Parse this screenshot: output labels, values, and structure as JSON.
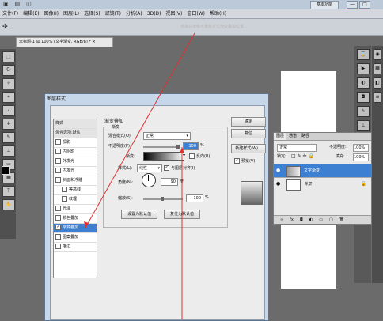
{
  "titlebar": {
    "workspace_button": "基本功能",
    "window_controls": [
      "—",
      "□",
      "×"
    ]
  },
  "menu": [
    "文件(F)",
    "编辑(E)",
    "图像(I)",
    "图层(L)",
    "选择(S)",
    "滤镜(T)",
    "分析(A)",
    "3D(D)",
    "视图(V)",
    "窗口(W)",
    "帮助(H)"
  ],
  "options_hint": "点按并拖移可重新定位渐变叠加位置...",
  "document_tab": "未标题-1 @ 100% (文字渐变, RGB/8) * ×",
  "layers_panel": {
    "tabs": [
      "图层",
      "通道",
      "路径"
    ],
    "blend_mode": "正常",
    "opacity_label": "不透明度:",
    "opacity_value": "100%",
    "lock_label": "锁定:",
    "fill_label": "填充:",
    "fill_value": "100%",
    "layers": [
      {
        "name": "文字渐变",
        "selected": true
      },
      {
        "name": "背景",
        "selected": false
      }
    ]
  },
  "dialog": {
    "title": "图层样式",
    "styles_header": "样式",
    "blend_options": "混合选项:默认",
    "style_items": [
      {
        "label": "投影",
        "checked": false,
        "indent": false
      },
      {
        "label": "内阴影",
        "checked": false,
        "indent": false
      },
      {
        "label": "外发光",
        "checked": false,
        "indent": false
      },
      {
        "label": "内发光",
        "checked": false,
        "indent": false
      },
      {
        "label": "斜面和浮雕",
        "checked": false,
        "indent": false
      },
      {
        "label": "等高线",
        "checked": false,
        "indent": true
      },
      {
        "label": "纹理",
        "checked": false,
        "indent": true
      },
      {
        "label": "光泽",
        "checked": false,
        "indent": false
      },
      {
        "label": "颜色叠加",
        "checked": false,
        "indent": false
      },
      {
        "label": "渐变叠加",
        "checked": true,
        "indent": false,
        "selected": true
      },
      {
        "label": "图案叠加",
        "checked": false,
        "indent": false
      },
      {
        "label": "描边",
        "checked": false,
        "indent": false
      }
    ],
    "section_title": "渐变叠加",
    "group_title": "渐变",
    "blend_mode_label": "混合模式(O):",
    "blend_mode_value": "正常",
    "opacity_label": "不透明度(P):",
    "opacity_value": "100",
    "percent": "%",
    "gradient_label": "渐变:",
    "reverse_label": "反向(R)",
    "style_label": "样式(L):",
    "style_value": "线性",
    "align_label": "与图层对齐(I)",
    "angle_label": "角度(N):",
    "angle_value": "90",
    "degree": "度",
    "scale_label": "缩放(S):",
    "scale_value": "100",
    "default_button": "设置为默认值",
    "reset_default_button": "复位为默认值",
    "ok_button": "确定",
    "reset_button": "复位",
    "new_style_button": "新建样式(W)...",
    "preview_label": "预览(V)"
  }
}
